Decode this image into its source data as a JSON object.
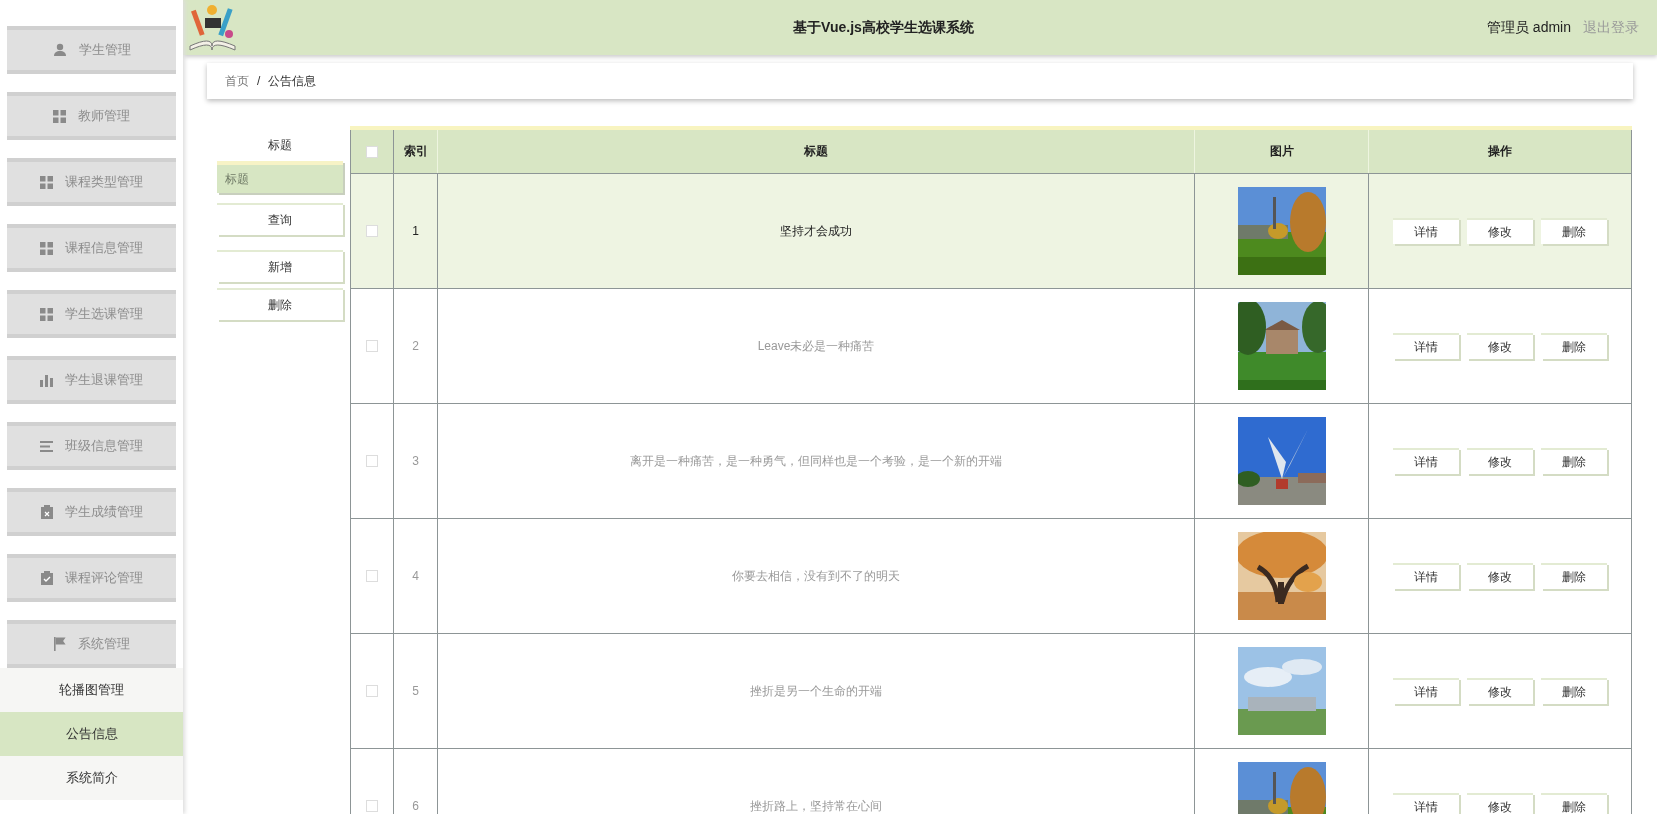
{
  "header": {
    "title": "基于Vue.js高校学生选课系统",
    "role": "管理员 admin",
    "logout": "退出登录"
  },
  "sidebar": {
    "items": [
      {
        "label": "学生管理",
        "kind": "user",
        "expanded": false
      },
      {
        "label": "教师管理",
        "kind": "grid",
        "expanded": false
      },
      {
        "label": "课程类型管理",
        "kind": "grid",
        "expanded": false
      },
      {
        "label": "课程信息管理",
        "kind": "grid",
        "expanded": false
      },
      {
        "label": "学生选课管理",
        "kind": "grid",
        "expanded": false
      },
      {
        "label": "学生退课管理",
        "kind": "chart",
        "expanded": false
      },
      {
        "label": "班级信息管理",
        "kind": "list",
        "expanded": false
      },
      {
        "label": "学生成绩管理",
        "kind": "clipx",
        "expanded": false
      },
      {
        "label": "课程评论管理",
        "kind": "clipcheck",
        "expanded": false
      },
      {
        "label": "系统管理",
        "kind": "flag",
        "expanded": true,
        "children": [
          {
            "label": "轮播图管理",
            "selected": false
          },
          {
            "label": "公告信息",
            "selected": true
          },
          {
            "label": "系统简介",
            "selected": false
          }
        ]
      }
    ]
  },
  "breadcrumb": [
    "首页",
    "/",
    "公告信息"
  ],
  "search": {
    "label": "标题",
    "placeholder": "标题",
    "buttons": [
      "查询",
      "新增",
      "删除"
    ]
  },
  "table": {
    "header_checked": false,
    "columns": [
      "索引",
      "标题",
      "图片",
      "操作"
    ],
    "rows": [
      {
        "index": "1",
        "title": "坚持才会成功",
        "checked": false,
        "selected": true,
        "actions": [
          "详情",
          "修改",
          "删除"
        ]
      },
      {
        "index": "2",
        "title": "Leave未必是一种痛苦",
        "checked": false,
        "selected": false,
        "actions": [
          "详情",
          "修改",
          "删除"
        ]
      },
      {
        "index": "3",
        "title": "离开是一种痛苦，是一种勇气，但同样也是一个考验，是一个新的开端",
        "checked": false,
        "selected": false,
        "actions": [
          "详情",
          "修改",
          "删除"
        ]
      },
      {
        "index": "4",
        "title": "你要去相信，没有到不了的明天",
        "checked": false,
        "selected": false,
        "actions": [
          "详情",
          "修改",
          "删除"
        ]
      },
      {
        "index": "5",
        "title": "挫折是另一个生命的开端",
        "checked": false,
        "selected": false,
        "actions": [
          "详情",
          "修改",
          "删除"
        ]
      },
      {
        "index": "6",
        "title": "挫折路上，坚持常在心间",
        "checked": false,
        "selected": false,
        "actions": [
          "详情",
          "修改",
          "删除"
        ]
      }
    ]
  }
}
